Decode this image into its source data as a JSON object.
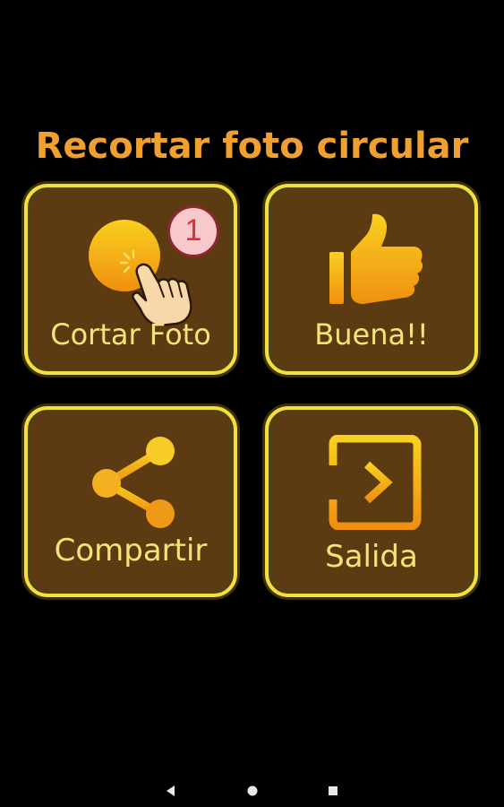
{
  "app": {
    "title": "Recortar foto circular"
  },
  "tiles": [
    {
      "id": "cortar",
      "label": "Cortar Foto",
      "icon": "crop-circle-hand-icon",
      "badge": "1"
    },
    {
      "id": "buena",
      "label": "Buena!!",
      "icon": "thumbs-up-icon"
    },
    {
      "id": "compartir",
      "label": "Compartir",
      "icon": "share-icon"
    },
    {
      "id": "salida",
      "label": "Salida",
      "icon": "exit-icon"
    }
  ],
  "nav": {
    "back_icon": "back-triangle-icon",
    "home_icon": "home-circle-icon",
    "recents_icon": "recents-square-icon"
  },
  "colors": {
    "background": "#000000",
    "tile_fill": "#5c3a12",
    "tile_border": "#f8dd40",
    "title": "#f0a030",
    "label": "#f7e27a",
    "icon_gradient_top": "#f8d020",
    "icon_gradient_bottom": "#f09010"
  }
}
